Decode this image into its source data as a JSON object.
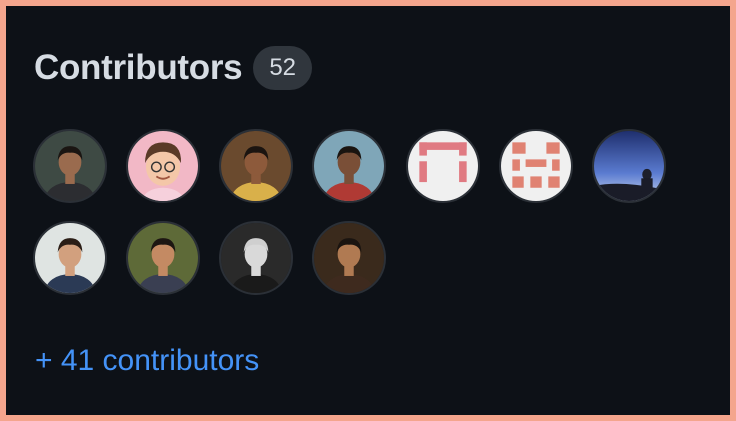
{
  "contributors": {
    "title": "Contributors",
    "count": "52",
    "more_link": "+ 41 contributors",
    "avatars": [
      {
        "kind": "photo",
        "bg": "#3e4a44",
        "skin": "#9a6b4e",
        "hair": "#1a1512",
        "shirt": "#2c2d31"
      },
      {
        "kind": "memoji",
        "bg": "#f2b8c6",
        "skin": "#f4c7a8",
        "hair": "#5a3a27",
        "shirt": "#e7b0c0"
      },
      {
        "kind": "photo",
        "bg": "#6a4a2e",
        "skin": "#8d5a3b",
        "hair": "#1b1410",
        "shirt": "#d9b04a"
      },
      {
        "kind": "photo",
        "bg": "#7fa6b8",
        "skin": "#7a4f37",
        "hair": "#1a1410",
        "shirt": "#b03a34"
      },
      {
        "kind": "identicon",
        "bg": "#f0f0f0",
        "color": "#e07a82"
      },
      {
        "kind": "identicon2",
        "bg": "#f0f0f0",
        "color": "#e08272"
      },
      {
        "kind": "sky",
        "bg": "#2a3d7a",
        "skin": "#1d1f2b",
        "hair": "#0e0f15",
        "shirt": "#1a1c28"
      },
      {
        "kind": "photo",
        "bg": "#dfe4e2",
        "skin": "#d2a07e",
        "hair": "#2a1d16",
        "shirt": "#2b3a55"
      },
      {
        "kind": "photo",
        "bg": "#5e6a38",
        "skin": "#c48a63",
        "hair": "#1d1612",
        "shirt": "#3a3f52"
      },
      {
        "kind": "photo",
        "bg": "#2a2a2a",
        "skin": "#d9d9d9",
        "hair": "#cfcfcf",
        "shirt": "#1a1a1a"
      },
      {
        "kind": "photo",
        "bg": "#3a2a1c",
        "skin": "#b07a52",
        "hair": "#1a1410",
        "shirt": "#3e2a1e"
      }
    ]
  }
}
